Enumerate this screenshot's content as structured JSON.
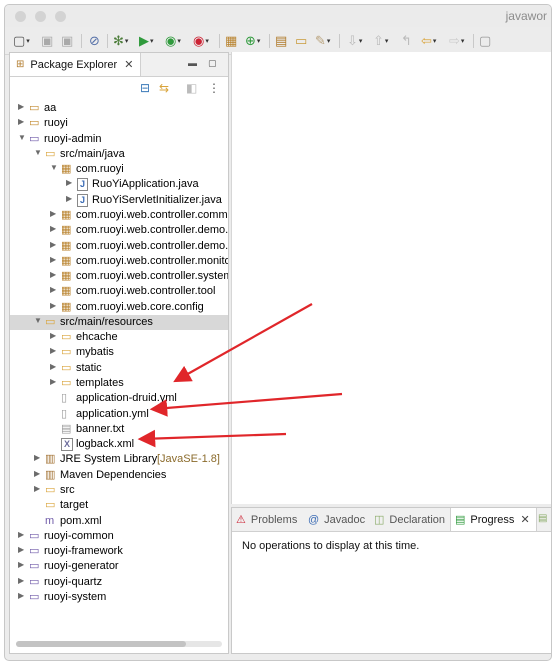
{
  "window": {
    "title": "javawor"
  },
  "package_explorer": {
    "tab_label": "Package Explorer",
    "tree": [
      {
        "label": "aa",
        "depth": 0,
        "arrow": "right",
        "icon": "project-icon"
      },
      {
        "label": "ruoyi",
        "depth": 0,
        "arrow": "right",
        "icon": "project-icon"
      },
      {
        "label": "ruoyi-admin",
        "depth": 0,
        "arrow": "down",
        "icon": "maven-project-icon"
      },
      {
        "label": "src/main/java",
        "depth": 1,
        "arrow": "down",
        "icon": "source-folder-icon"
      },
      {
        "label": "com.ruoyi",
        "depth": 2,
        "arrow": "down",
        "icon": "package-icon"
      },
      {
        "label": "RuoYiApplication.java",
        "depth": 3,
        "arrow": "right",
        "icon": "java-file-icon"
      },
      {
        "label": "RuoYiServletInitializer.java",
        "depth": 3,
        "arrow": "right",
        "icon": "java-file-icon"
      },
      {
        "label": "com.ruoyi.web.controller.common",
        "depth": 2,
        "arrow": "right",
        "icon": "package-icon"
      },
      {
        "label": "com.ruoyi.web.controller.demo.c",
        "depth": 2,
        "arrow": "right",
        "icon": "package-icon"
      },
      {
        "label": "com.ruoyi.web.controller.demo.d",
        "depth": 2,
        "arrow": "right",
        "icon": "package-icon"
      },
      {
        "label": "com.ruoyi.web.controller.monito",
        "depth": 2,
        "arrow": "right",
        "icon": "package-icon"
      },
      {
        "label": "com.ruoyi.web.controller.system",
        "depth": 2,
        "arrow": "right",
        "icon": "package-icon"
      },
      {
        "label": "com.ruoyi.web.controller.tool",
        "depth": 2,
        "arrow": "right",
        "icon": "package-icon"
      },
      {
        "label": "com.ruoyi.web.core.config",
        "depth": 2,
        "arrow": "right",
        "icon": "package-icon"
      },
      {
        "label": "src/main/resources",
        "depth": 1,
        "arrow": "down",
        "icon": "source-folder-icon",
        "selected": true
      },
      {
        "label": "ehcache",
        "depth": 2,
        "arrow": "right",
        "icon": "folder-icon"
      },
      {
        "label": "mybatis",
        "depth": 2,
        "arrow": "right",
        "icon": "folder-icon"
      },
      {
        "label": "static",
        "depth": 2,
        "arrow": "right",
        "icon": "folder-icon"
      },
      {
        "label": "templates",
        "depth": 2,
        "arrow": "right",
        "icon": "folder-icon"
      },
      {
        "label": "application-druid.yml",
        "depth": 2,
        "arrow": "",
        "icon": "yml-file-icon"
      },
      {
        "label": "application.yml",
        "depth": 2,
        "arrow": "",
        "icon": "yml-file-icon"
      },
      {
        "label": "banner.txt",
        "depth": 2,
        "arrow": "",
        "icon": "text-file-icon"
      },
      {
        "label": "logback.xml",
        "depth": 2,
        "arrow": "",
        "icon": "xml-file-icon"
      },
      {
        "label": "JRE System Library",
        "decoration": "[JavaSE-1.8]",
        "depth": 1,
        "arrow": "right",
        "icon": "library-icon"
      },
      {
        "label": "Maven Dependencies",
        "depth": 1,
        "arrow": "right",
        "icon": "library-icon"
      },
      {
        "label": "src",
        "depth": 1,
        "arrow": "right",
        "icon": "folder-icon"
      },
      {
        "label": "target",
        "depth": 1,
        "arrow": "",
        "icon": "folder-icon"
      },
      {
        "label": "pom.xml",
        "depth": 1,
        "arrow": "",
        "icon": "maven-file-icon"
      },
      {
        "label": "ruoyi-common",
        "depth": 0,
        "arrow": "right",
        "icon": "maven-project-icon"
      },
      {
        "label": "ruoyi-framework",
        "depth": 0,
        "arrow": "right",
        "icon": "maven-project-icon"
      },
      {
        "label": "ruoyi-generator",
        "depth": 0,
        "arrow": "right",
        "icon": "maven-project-icon"
      },
      {
        "label": "ruoyi-quartz",
        "depth": 0,
        "arrow": "right",
        "icon": "maven-project-icon"
      },
      {
        "label": "ruoyi-system",
        "depth": 0,
        "arrow": "right",
        "icon": "maven-project-icon"
      }
    ]
  },
  "bottom_panel": {
    "tabs": [
      {
        "label": "Problems",
        "icon": "problems-icon"
      },
      {
        "label": "Javadoc",
        "icon": "javadoc-icon"
      },
      {
        "label": "Declaration",
        "icon": "declaration-icon"
      },
      {
        "label": "Progress",
        "icon": "progress-icon",
        "active": true
      }
    ],
    "message": "No operations to display at this time."
  },
  "colors": {
    "annotation_arrow": "#e0262a",
    "selection": "#d8d8d8"
  }
}
